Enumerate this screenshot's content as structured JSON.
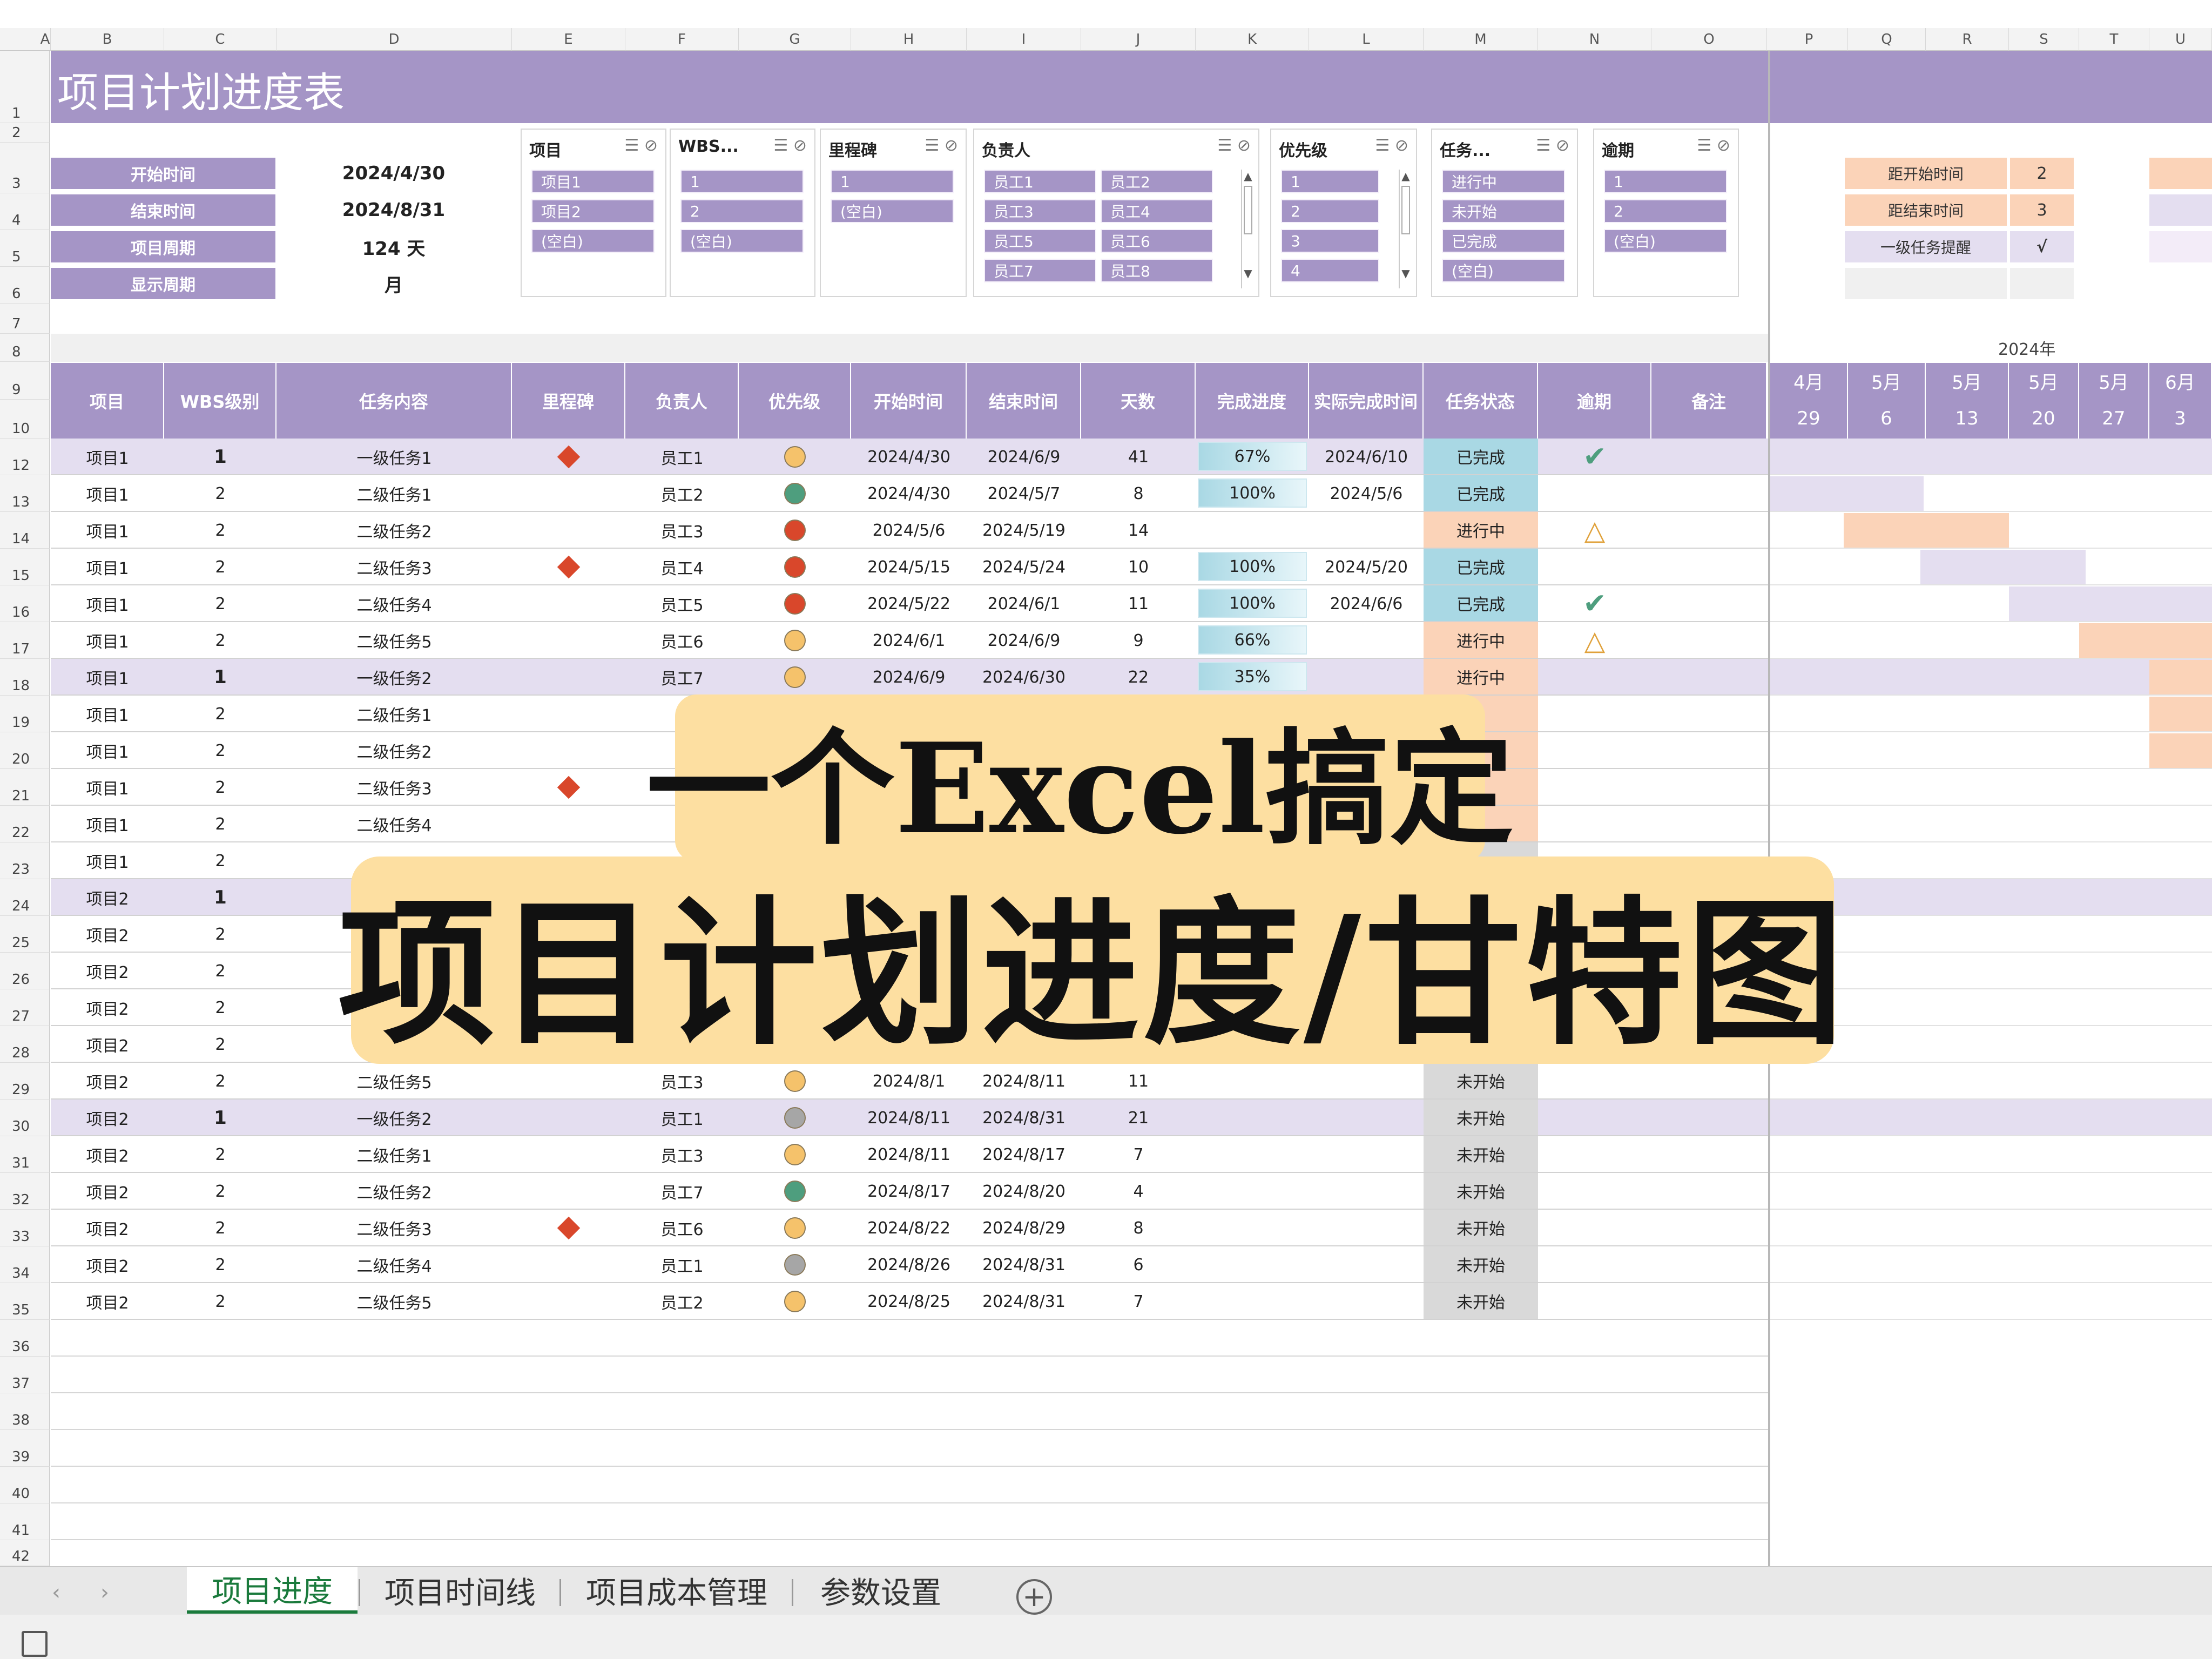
{
  "title": "项目计划进度表",
  "column_letters": [
    "A",
    "B",
    "C",
    "D",
    "E",
    "F",
    "G",
    "H",
    "I",
    "J",
    "K",
    "L",
    "M",
    "N",
    "O",
    "P",
    "Q",
    "R",
    "S",
    "T",
    "U"
  ],
  "row_numbers": [
    "1",
    "2",
    "3",
    "4",
    "5",
    "6",
    "7",
    "8",
    "9",
    "10",
    "12",
    "13",
    "14",
    "15",
    "16",
    "17",
    "18",
    "19",
    "20",
    "21",
    "22",
    "23",
    "24",
    "25",
    "26",
    "27",
    "28",
    "29",
    "30",
    "31",
    "32",
    "33",
    "34",
    "35",
    "36",
    "37",
    "38",
    "39",
    "40",
    "41",
    "42"
  ],
  "info": [
    {
      "label": "开始时间",
      "value": "2024/4/30"
    },
    {
      "label": "结束时间",
      "value": "2024/8/31"
    },
    {
      "label": "项目周期",
      "value": "124 天"
    },
    {
      "label": "显示周期",
      "value": "月"
    }
  ],
  "slicers": {
    "project": {
      "title": "项目",
      "items": [
        "项目1",
        "项目2",
        "(空白)"
      ]
    },
    "wbs": {
      "title": "WBS...",
      "items": [
        "1",
        "2",
        "(空白)"
      ]
    },
    "milestone": {
      "title": "里程碑",
      "items": [
        "1",
        "(空白)"
      ]
    },
    "owner": {
      "title": "负责人",
      "items": [
        "员工1",
        "员工2",
        "员工3",
        "员工4",
        "员工5",
        "员工6",
        "员工7",
        "员工8"
      ]
    },
    "priority": {
      "title": "优先级",
      "items": [
        "1",
        "2",
        "3",
        "4"
      ]
    },
    "task_status": {
      "title": "任务...",
      "items": [
        "进行中",
        "未开始",
        "已完成",
        "(空白)"
      ]
    },
    "overdue": {
      "title": "逾期",
      "items": [
        "1",
        "2",
        "(空白)"
      ]
    }
  },
  "params": [
    {
      "label": "距开始时间",
      "value": "2"
    },
    {
      "label": "距结束时间",
      "value": "3"
    },
    {
      "label": "一级任务提醒",
      "value": "√"
    }
  ],
  "gantt_year": "2024年",
  "gantt_weeks": [
    {
      "month": "4月",
      "day": "29"
    },
    {
      "month": "5月",
      "day": "6"
    },
    {
      "month": "5月",
      "day": "13"
    },
    {
      "month": "5月",
      "day": "20"
    },
    {
      "month": "5月",
      "day": "27"
    },
    {
      "month": "6月",
      "day": "3"
    }
  ],
  "headers": [
    "项目",
    "WBS级别",
    "任务内容",
    "里程碑",
    "负责人",
    "优先级",
    "开始时间",
    "结束时间",
    "天数",
    "完成进度",
    "实际完成时间",
    "任务状态",
    "逾期",
    "备注"
  ],
  "tasks": [
    {
      "project": "项目1",
      "wbs": "1",
      "task": "一级任务1",
      "milestone": true,
      "owner": "员工1",
      "priority": "yellow",
      "start": "2024/4/30",
      "end": "2024/6/9",
      "days": "41",
      "progress": "67%",
      "actual": "2024/6/10",
      "status": "已完成",
      "overdue": "check",
      "level": 1
    },
    {
      "project": "项目1",
      "wbs": "2",
      "task": "二级任务1",
      "milestone": false,
      "owner": "员工2",
      "priority": "green",
      "start": "2024/4/30",
      "end": "2024/5/7",
      "days": "8",
      "progress": "100%",
      "actual": "2024/5/6",
      "status": "已完成",
      "overdue": "",
      "level": 2
    },
    {
      "project": "项目1",
      "wbs": "2",
      "task": "二级任务2",
      "milestone": false,
      "owner": "员工3",
      "priority": "red",
      "start": "2024/5/6",
      "end": "2024/5/19",
      "days": "14",
      "progress": "",
      "actual": "",
      "status": "进行中",
      "overdue": "warn",
      "level": 2
    },
    {
      "project": "项目1",
      "wbs": "2",
      "task": "二级任务3",
      "milestone": true,
      "owner": "员工4",
      "priority": "red",
      "start": "2024/5/15",
      "end": "2024/5/24",
      "days": "10",
      "progress": "100%",
      "actual": "2024/5/20",
      "status": "已完成",
      "overdue": "",
      "level": 2
    },
    {
      "project": "项目1",
      "wbs": "2",
      "task": "二级任务4",
      "milestone": false,
      "owner": "员工5",
      "priority": "red",
      "start": "2024/5/22",
      "end": "2024/6/1",
      "days": "11",
      "progress": "100%",
      "actual": "2024/6/6",
      "status": "已完成",
      "overdue": "check",
      "level": 2
    },
    {
      "project": "项目1",
      "wbs": "2",
      "task": "二级任务5",
      "milestone": false,
      "owner": "员工6",
      "priority": "yellow",
      "start": "2024/6/1",
      "end": "2024/6/9",
      "days": "9",
      "progress": "66%",
      "actual": "",
      "status": "进行中",
      "overdue": "warn",
      "level": 2
    },
    {
      "project": "项目1",
      "wbs": "1",
      "task": "一级任务2",
      "milestone": false,
      "owner": "员工7",
      "priority": "yellow",
      "start": "2024/6/9",
      "end": "2024/6/30",
      "days": "22",
      "progress": "35%",
      "actual": "",
      "status": "进行中",
      "overdue": "",
      "level": 1
    },
    {
      "project": "项目1",
      "wbs": "2",
      "task": "二级任务1",
      "milestone": false,
      "owner": "",
      "priority": "",
      "start": "",
      "end": "",
      "days": "",
      "progress": "",
      "actual": "",
      "status": "",
      "overdue": "",
      "level": 2
    },
    {
      "project": "项目1",
      "wbs": "2",
      "task": "二级任务2",
      "milestone": false,
      "owner": "",
      "priority": "",
      "start": "",
      "end": "",
      "days": "",
      "progress": "",
      "actual": "",
      "status": "",
      "overdue": "",
      "level": 2
    },
    {
      "project": "项目1",
      "wbs": "2",
      "task": "二级任务3",
      "milestone": true,
      "owner": "",
      "priority": "",
      "start": "",
      "end": "",
      "days": "",
      "progress": "",
      "actual": "",
      "status": "",
      "overdue": "",
      "level": 2
    },
    {
      "project": "项目1",
      "wbs": "2",
      "task": "二级任务4",
      "milestone": false,
      "owner": "",
      "priority": "",
      "start": "",
      "end": "",
      "days": "",
      "progress": "",
      "actual": "",
      "status": "",
      "overdue": "",
      "level": 2
    },
    {
      "project": "项目1",
      "wbs": "2",
      "task": "",
      "milestone": false,
      "owner": "",
      "priority": "",
      "start": "",
      "end": "",
      "days": "",
      "progress": "",
      "actual": "",
      "status": "",
      "overdue": "",
      "level": 2
    },
    {
      "project": "项目2",
      "wbs": "1",
      "task": "",
      "milestone": false,
      "owner": "",
      "priority": "",
      "start": "",
      "end": "",
      "days": "",
      "progress": "",
      "actual": "",
      "status": "",
      "overdue": "",
      "level": 1
    },
    {
      "project": "项目2",
      "wbs": "2",
      "task": "",
      "milestone": false,
      "owner": "",
      "priority": "",
      "start": "",
      "end": "",
      "days": "",
      "progress": "",
      "actual": "",
      "status": "",
      "overdue": "",
      "level": 2
    },
    {
      "project": "项目2",
      "wbs": "2",
      "task": "",
      "milestone": false,
      "owner": "",
      "priority": "",
      "start": "",
      "end": "",
      "days": "",
      "progress": "",
      "actual": "",
      "status": "",
      "overdue": "",
      "level": 2
    },
    {
      "project": "项目2",
      "wbs": "2",
      "task": "",
      "milestone": false,
      "owner": "",
      "priority": "",
      "start": "",
      "end": "",
      "days": "",
      "progress": "",
      "actual": "",
      "status": "",
      "overdue": "",
      "level": 2
    },
    {
      "project": "项目2",
      "wbs": "2",
      "task": "",
      "milestone": false,
      "owner": "",
      "priority": "",
      "start": "",
      "end": "",
      "days": "",
      "progress": "",
      "actual": "",
      "status": "",
      "overdue": "",
      "level": 2
    },
    {
      "project": "项目2",
      "wbs": "2",
      "task": "二级任务5",
      "milestone": false,
      "owner": "员工3",
      "priority": "yellow",
      "start": "2024/8/1",
      "end": "2024/8/11",
      "days": "11",
      "progress": "",
      "actual": "",
      "status": "未开始",
      "overdue": "",
      "level": 2
    },
    {
      "project": "项目2",
      "wbs": "1",
      "task": "一级任务2",
      "milestone": false,
      "owner": "员工1",
      "priority": "gray",
      "start": "2024/8/11",
      "end": "2024/8/31",
      "days": "21",
      "progress": "",
      "actual": "",
      "status": "未开始",
      "overdue": "",
      "level": 1
    },
    {
      "project": "项目2",
      "wbs": "2",
      "task": "二级任务1",
      "milestone": false,
      "owner": "员工3",
      "priority": "yellow",
      "start": "2024/8/11",
      "end": "2024/8/17",
      "days": "7",
      "progress": "",
      "actual": "",
      "status": "未开始",
      "overdue": "",
      "level": 2
    },
    {
      "project": "项目2",
      "wbs": "2",
      "task": "二级任务2",
      "milestone": false,
      "owner": "员工7",
      "priority": "green",
      "start": "2024/8/17",
      "end": "2024/8/20",
      "days": "4",
      "progress": "",
      "actual": "",
      "status": "未开始",
      "overdue": "",
      "level": 2
    },
    {
      "project": "项目2",
      "wbs": "2",
      "task": "二级任务3",
      "milestone": true,
      "owner": "员工6",
      "priority": "yellow",
      "start": "2024/8/22",
      "end": "2024/8/29",
      "days": "8",
      "progress": "",
      "actual": "",
      "status": "未开始",
      "overdue": "",
      "level": 2
    },
    {
      "project": "项目2",
      "wbs": "2",
      "task": "二级任务4",
      "milestone": false,
      "owner": "员工1",
      "priority": "gray",
      "start": "2024/8/26",
      "end": "2024/8/31",
      "days": "6",
      "progress": "",
      "actual": "",
      "status": "未开始",
      "overdue": "",
      "level": 2
    },
    {
      "project": "项目2",
      "wbs": "2",
      "task": "二级任务5",
      "milestone": false,
      "owner": "员工2",
      "priority": "yellow",
      "start": "2024/8/25",
      "end": "2024/8/31",
      "days": "7",
      "progress": "",
      "actual": "",
      "status": "未开始",
      "overdue": "",
      "level": 2
    }
  ],
  "colors": {
    "header_purple": "#a595c6",
    "level1_row": "#e4def0",
    "done": "#a9d8e4",
    "in_progress": "#fbd3b8",
    "not_started": "#d9d9d9",
    "priority": {
      "yellow": "#f5c26b",
      "green": "#4e9e7e",
      "red": "#d9472b",
      "gray": "#a6a6a6"
    }
  },
  "sheet_tabs": [
    "项目进度",
    "项目时间线",
    "项目成本管理",
    "参数设置"
  ],
  "overlay": {
    "line1": "一个Excel搞定",
    "line2": "项目计划进度/甘特图"
  }
}
